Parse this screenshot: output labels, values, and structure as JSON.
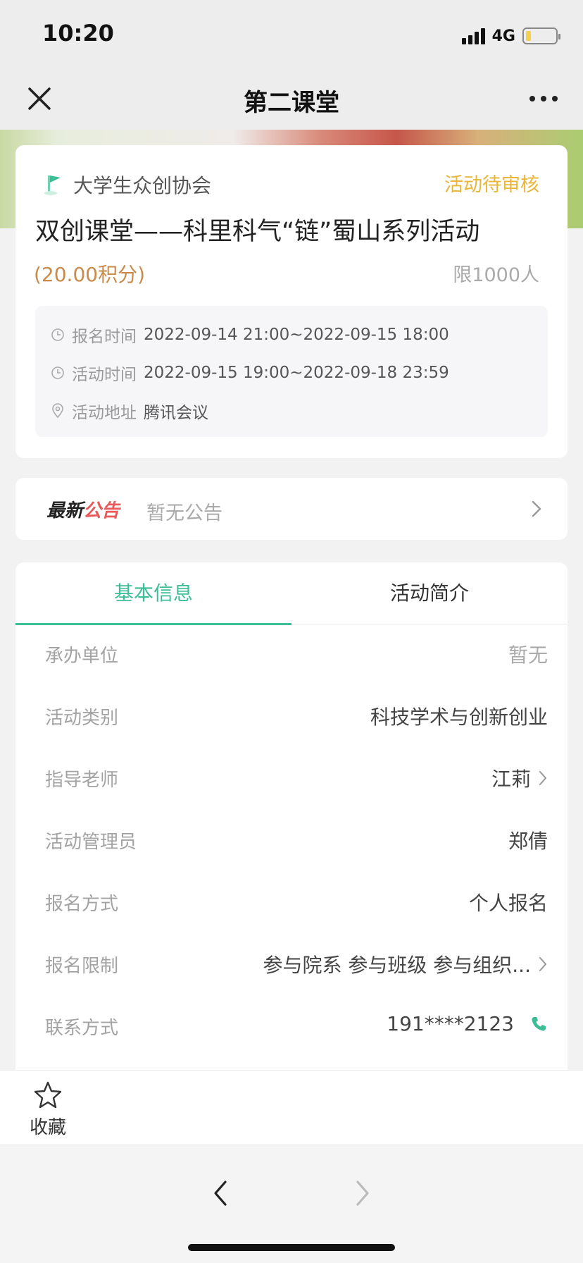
{
  "status_bar": {
    "time": "10:20",
    "network": "4G"
  },
  "nav": {
    "title": "第二课堂"
  },
  "activity": {
    "org_name": "大学生众创协会",
    "status": "活动待审核",
    "title": "双创课堂——科里科气“链”蜀山系列活动",
    "points": "(20.00积分)",
    "limit": "限1000人",
    "signup_time_label": "报名时间",
    "signup_time_value": "2022-09-14 21:00~2022-09-15 18:00",
    "activity_time_label": "活动时间",
    "activity_time_value": "2022-09-15 19:00~2022-09-18 23:59",
    "address_label": "活动地址",
    "address_value": "腾讯会议"
  },
  "notice": {
    "title_part1": "最新",
    "title_part2": "公告",
    "text": "暂无公告"
  },
  "tabs": [
    {
      "label": "基本信息",
      "active": true
    },
    {
      "label": "活动简介",
      "active": false
    }
  ],
  "details": [
    {
      "label": "承办单位",
      "value": "暂无"
    },
    {
      "label": "活动类别",
      "value": "科技学术与创新创业"
    },
    {
      "label": "指导老师",
      "value": "江莉"
    },
    {
      "label": "活动管理员",
      "value": "郑倩"
    },
    {
      "label": "报名方式",
      "value": "个人报名"
    },
    {
      "label": "报名限制",
      "value": "参与院系 参与班级 参与组织..."
    },
    {
      "label": "联系方式",
      "value": "191****2123"
    }
  ],
  "bottom": {
    "favorite_label": "收藏"
  },
  "colors": {
    "accent": "#3dbd96",
    "status": "#e7b63b",
    "points": "#c98a4a",
    "notice_red": "#e85a5a"
  }
}
